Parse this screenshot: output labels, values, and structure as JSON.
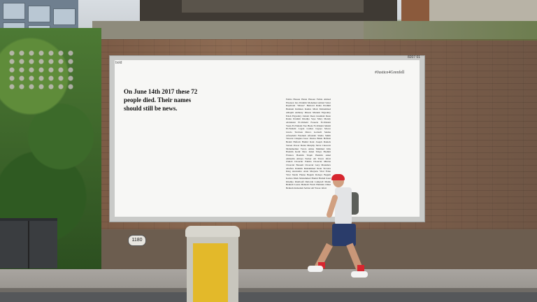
{
  "billboard": {
    "logo": "bold",
    "code": "8207 01",
    "headline": "On June 14th 2017 these 72 people died. Their names should still be news.",
    "hashtag": "#Justice4Grenfell",
    "names": "Fethia Hassan Hania Hassan Fathia Ahmed Elsanosi Isra Ibrahim Mohamed Amied Saber Raymond \"Moses\" Bernard Rania Ibrahim Hesham Rahman Kamru Miah Mohammed Alhajali Anthony Disson Mariem Elgwahry Eslah Elgwahry Zainab Deen Jeremiah Deen Rania Ibrahim Khadija Saye Mary Mendy Abdulaziz El-Wahabi Faouzia El-Wahabi Yasin El-Wahabi Nur Huda El-Wahabi Mehdi El-Wahabi Logan Gomes Ligaya Moore Gloria Trevisan Marco Gottardi Sakina Afrasehabi Fatemeh Afrasiabi Sheila Smith Vincent Chiejina Isaac Paulos Biruk Haftom Berkti Haftom Hamid Kani Joseph Daniels Steven Power Denis Murphy Sirria Choucair Mohamednur Tuccu Amna Mahmud Idris Hashim Kedir Nura Jemal Yahya Hashim Firdaws Hashim Yaqub Hashim Amal Ahmedin Amaya Tucker Ali Yawar Jafari Zainab Choucair Fatima Choucair Mierna Choucair Bassem Choucair Gary Maunders Abufars Ibrahim Mohammed Neda Victoria King Alexandra Atala Marjorie Vital Ernie Vital Sheila Husna Begum Rabeya Begum Kamru Miah Mohammed Hamid Hamid Kani Khadija Khalloufi Deborah Lamprell Malak Belkadi Leena Belkadi Farah Hamdan Omar Belkadi Abdeslam Sebbar Ali Yawar Jafari"
  },
  "plate": {
    "number": "1180"
  }
}
